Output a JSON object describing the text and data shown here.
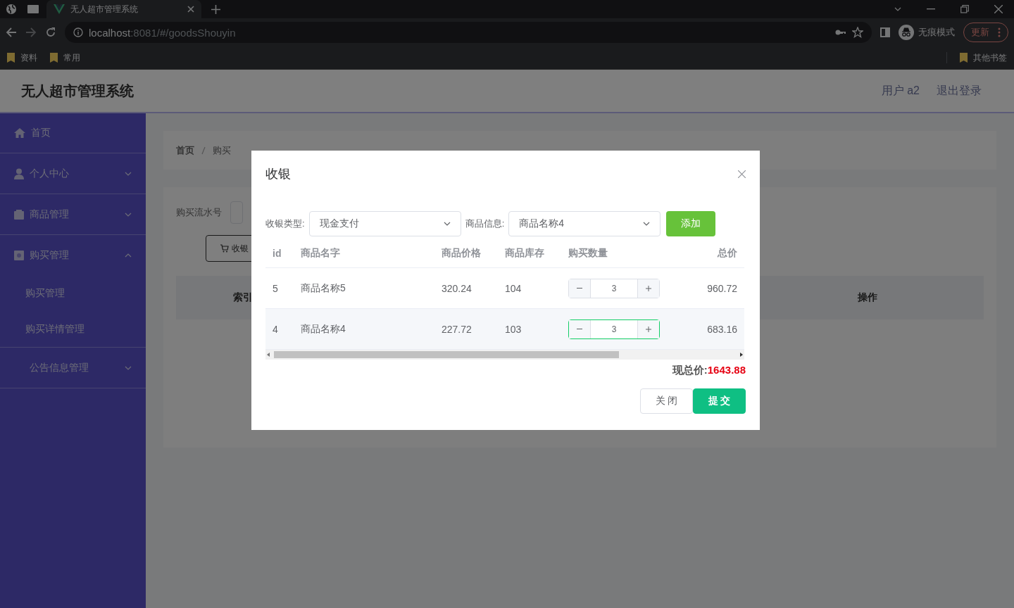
{
  "browser": {
    "tabs": [
      {
        "title": "无人超市管理系统",
        "selected": true
      }
    ],
    "url": {
      "host": "localhost",
      "path": ":8081/#/goodsShouyin"
    },
    "profile_label": "无痕模式",
    "update_button": "更新",
    "bookmarks": [
      "资料",
      "常用"
    ],
    "other_bookmarks": "其他书签"
  },
  "header": {
    "title": "无人超市管理系统",
    "user": "用户 a2",
    "logout": "退出登录"
  },
  "sidebar": {
    "items": [
      {
        "label": "首页",
        "kind": "link"
      },
      {
        "label": "个人中心",
        "kind": "submenu",
        "expanded": false
      },
      {
        "label": "商品管理",
        "kind": "submenu",
        "expanded": false
      },
      {
        "label": "购买管理",
        "kind": "submenu",
        "expanded": true,
        "children": [
          {
            "label": "购买管理"
          },
          {
            "label": "购买详情管理"
          }
        ]
      },
      {
        "label": "公告信息管理",
        "kind": "submenu",
        "expanded": false
      }
    ]
  },
  "breadcrumb": [
    "首页",
    "购买"
  ],
  "search": {
    "label": "购买流水号"
  },
  "cashier_button": "收银",
  "table": {
    "columns": [
      "索引",
      "操作"
    ]
  },
  "dialog": {
    "title": "收银",
    "payment_label": "收银类型:",
    "payment_value": "现金支付",
    "product_label": "商品信息:",
    "product_value": "商品名称4",
    "add_button": "添加",
    "columns": [
      "id",
      "商品名字",
      "商品价格",
      "商品库存",
      "购买数量",
      "总价"
    ],
    "rows": [
      {
        "id": "5",
        "name": "商品名称5",
        "price": "320.24",
        "stock": "104",
        "quantity": "3",
        "total": "960.72",
        "selected": false
      },
      {
        "id": "4",
        "name": "商品名称4",
        "price": "227.72",
        "stock": "103",
        "quantity": "3",
        "total": "683.16",
        "selected": true
      }
    ],
    "total_label": "现总价:",
    "total_value": "1643.88",
    "close_button": "关 闭",
    "submit_button": "提 交"
  }
}
